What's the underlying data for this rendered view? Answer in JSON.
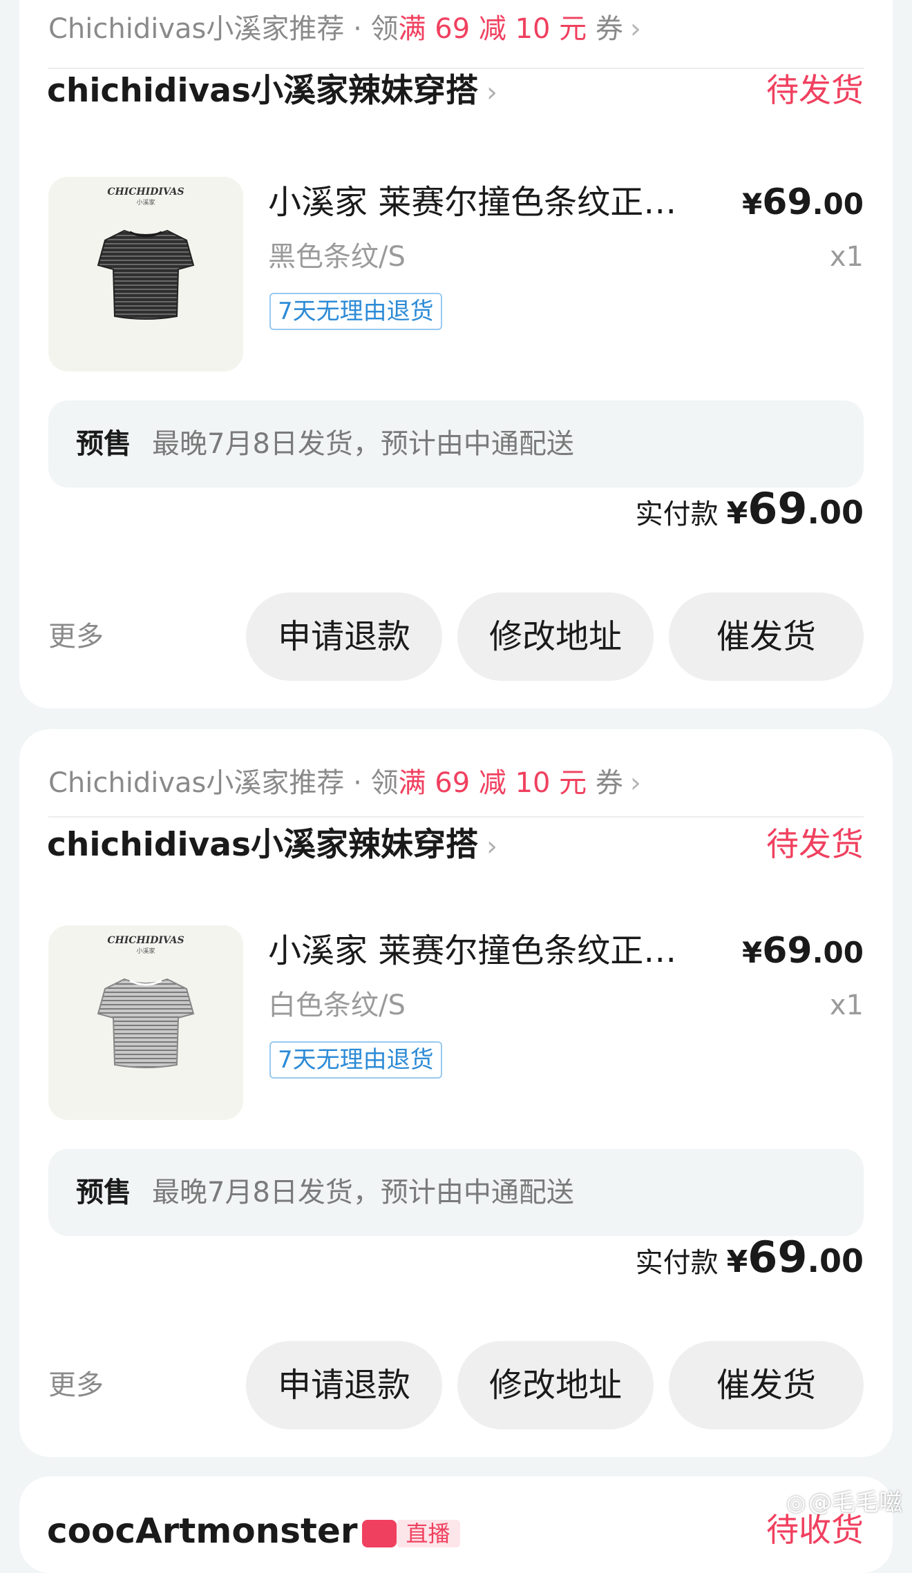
{
  "orders": [
    {
      "promo": {
        "prefix": "Chichidivas小溪家推荐 · 领",
        "highlight": "满 69 减 10 元",
        "suffix": " 券"
      },
      "shop_name": "chichidivas小溪家辣妹穿搭",
      "status": "待发货",
      "product": {
        "title": "小溪家 莱赛尔撞色条纹正肩短袖T恤",
        "sku": "黑色条纹/S",
        "tag": "7天无理由退货",
        "price_symbol": "¥",
        "price_int": "69",
        "price_dec": ".00",
        "quantity": "x1",
        "image_logo": "CHICHIDIVAS",
        "image_sub": "小溪家",
        "shirt_color": "#3a3a3a"
      },
      "presale": {
        "label": "预售",
        "text": "最晚7月8日发货，预计由中通配送"
      },
      "paid": {
        "label": "实付款",
        "symbol": "¥",
        "int": "69",
        "dec": ".00"
      },
      "actions": {
        "more": "更多",
        "refund": "申请退款",
        "change_address": "修改地址",
        "urge": "催发货"
      }
    },
    {
      "promo": {
        "prefix": "Chichidivas小溪家推荐 · 领",
        "highlight": "满 69 减 10 元",
        "suffix": " 券"
      },
      "shop_name": "chichidivas小溪家辣妹穿搭",
      "status": "待发货",
      "product": {
        "title": "小溪家 莱赛尔撞色条纹正肩短袖T恤",
        "sku": "白色条纹/S",
        "tag": "7天无理由退货",
        "price_symbol": "¥",
        "price_int": "69",
        "price_dec": ".00",
        "quantity": "x1",
        "image_logo": "CHICHIDIVAS",
        "image_sub": "小溪家",
        "shirt_color": "#a9a9a9"
      },
      "presale": {
        "label": "预售",
        "text": "最晚7月8日发货，预计由中通配送"
      },
      "paid": {
        "label": "实付款",
        "symbol": "¥",
        "int": "69",
        "dec": ".00"
      },
      "actions": {
        "more": "更多",
        "refund": "申请退款",
        "change_address": "修改地址",
        "urge": "催发货"
      }
    }
  ],
  "next_order": {
    "shop_name": "coocArtmonster",
    "badge": "直播",
    "status": "待收货"
  },
  "watermark": "@毛毛嗞",
  "colors": {
    "accent": "#f0405f",
    "tag_blue": "#2d8bd6",
    "background": "#f1f5f5"
  }
}
